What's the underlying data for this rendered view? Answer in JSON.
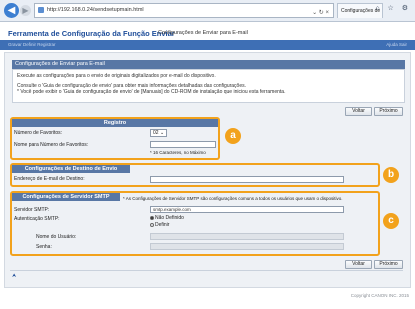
{
  "browser": {
    "url": "http://192.168.0.24/sendsetupmain.html",
    "tab_label": "Configurações de Envi...",
    "address_tools": "⌄ ↻ ×",
    "window_icons": "⌂ ☆ ⚙"
  },
  "header": {
    "app_title": "Ferramenta de Configuração da Função Enviar",
    "page_subtitle": "Configurações de Enviar para E-mail",
    "band_left": "Gravar  Definir  Registrar",
    "band_right": "Ajuda  Sair"
  },
  "section": {
    "title": "Configurações de Enviar para E-mail",
    "desc1": "Execute as configurações para o envio de originais digitalizados por e-mail do dispositivo.",
    "desc2": "Consulte o 'Guia de configuração de envio' para obter mais informações detalhadas das configurações.",
    "desc3": "* Você pode exibir o 'Guia de configuração de envio' de [Manuais] do CD-ROM de instalação que iniciou esta ferramenta."
  },
  "buttons": {
    "back": "Voltar",
    "next": "Próximo"
  },
  "registro": {
    "title": "Registro",
    "fav_number_label": "Número de Favoritos:",
    "fav_number_value": "02",
    "fav_name_label": "Nome para Número de Favoritos:",
    "fav_name_value": "",
    "fav_name_hint": "* 16 Caracteres, no Máximo",
    "badge": "a"
  },
  "destino": {
    "title": "Configurações de Destino de Envio",
    "email_label": "Endereço de E-mail de Destino:",
    "email_value": "",
    "badge": "b"
  },
  "smtp": {
    "title": "Configurações de Servidor SMTP",
    "note": "* As Configurações de Servidor SMTP são configurações comuns a todos os usuários que usam o dispositivo.",
    "server_label": "Servidor SMTP:",
    "server_value": "smtp.example.com",
    "auth_label": "Autenticação SMTP:",
    "auth_option1": "Não Definido",
    "auth_option2": "Definir",
    "user_label": "Nome do Usuário:",
    "password_label": "Senha:",
    "badge": "c"
  },
  "footer": {
    "top_link": "⮝",
    "copyright": "Copyright CANON INC. 2015"
  }
}
